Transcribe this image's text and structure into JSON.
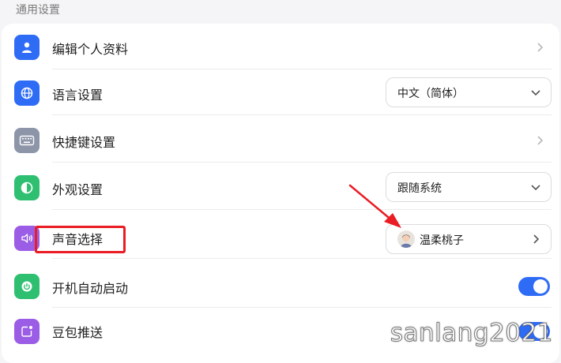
{
  "section": {
    "title": "通用设置"
  },
  "colors": {
    "accent": "#2f6cf6",
    "annotation": "#ea1c24",
    "icon_profile": "#2f6cf6",
    "icon_language": "#2f6cf6",
    "icon_shortcut": "#8d95a8",
    "icon_appearance": "#2fbf71",
    "icon_sound": "#9b5de5",
    "icon_startup": "#2fbf71",
    "icon_push": "#9b5de5"
  },
  "settings": {
    "profile": {
      "label": "编辑个人资料",
      "icon": "person-icon"
    },
    "language": {
      "label": "语言设置",
      "icon": "globe-icon",
      "value": "中文（简体）"
    },
    "shortcut": {
      "label": "快捷键设置",
      "icon": "keyboard-icon"
    },
    "appearance": {
      "label": "外观设置",
      "icon": "half-circle-icon",
      "value": "跟随系统"
    },
    "sound": {
      "label": "声音选择",
      "icon": "speaker-icon",
      "value": "温柔桃子"
    },
    "startup": {
      "label": "开机自动启动",
      "icon": "power-icon",
      "enabled": true
    },
    "push": {
      "label": "豆包推送",
      "icon": "notification-icon",
      "enabled": true
    }
  },
  "watermark": {
    "text": "sanlang2021"
  }
}
